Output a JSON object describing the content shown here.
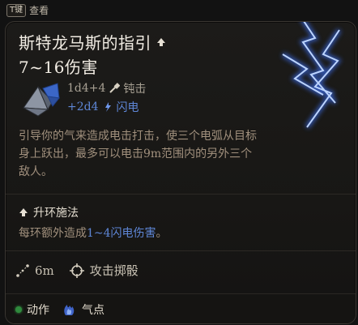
{
  "hint": {
    "key": "T键",
    "label": "查看"
  },
  "spell": {
    "name": "斯特龙马斯的指引",
    "damage_range": "7~16伤害",
    "damage_lines": [
      {
        "dice": "1d4+4",
        "type": "钝击"
      },
      {
        "dice": "+2d4",
        "type": "闪电"
      }
    ],
    "description": "引导你的气来造成电击打击，使三个电弧从目标身上跃出，最多可以电击9m范围内的另外三个敌人。"
  },
  "upcast": {
    "title": "升环施法",
    "prefix": "每环额外造成",
    "highlight": "1~4闪电伤害",
    "suffix": "。"
  },
  "info": {
    "range": "6m",
    "attack": "攻击掷骰"
  },
  "footer": {
    "action": "动作",
    "ki": "气点"
  },
  "colors": {
    "lightning": "#5e86d6",
    "description": "#a1907d",
    "action_dot": "#2f8a3d"
  },
  "icons": [
    "upcast-icon",
    "dice-icon",
    "blunt-icon",
    "lightning-icon",
    "range-icon",
    "crosshair-icon",
    "ki-icon"
  ]
}
